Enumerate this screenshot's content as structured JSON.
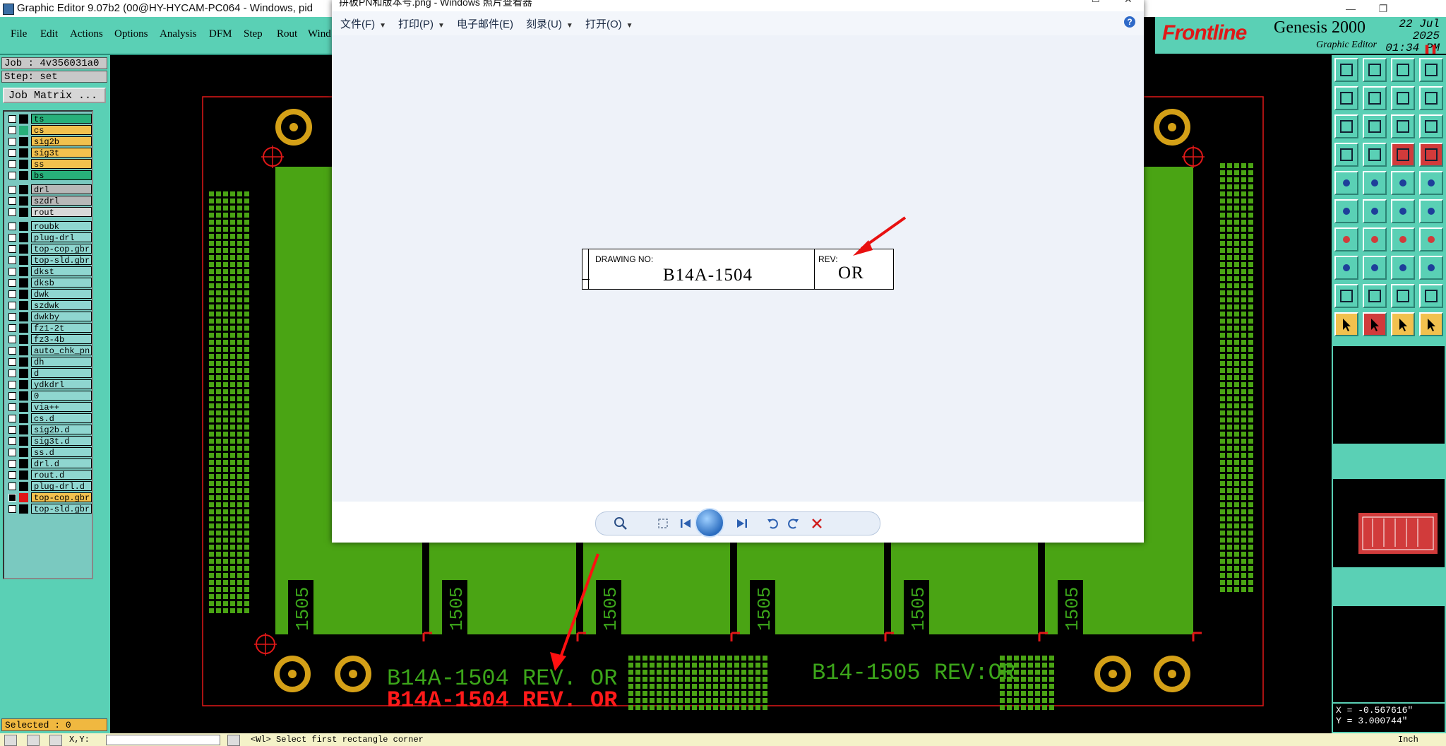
{
  "window": {
    "title": "Graphic Editor 9.07b2 (00@HY-HYCAM-PC064 - Windows, pid",
    "controls": [
      "—",
      "❐"
    ]
  },
  "menubar": {
    "items": [
      "File",
      "Edit",
      "Actions",
      "Options",
      "Analysis",
      "DFM",
      "Step",
      "Rout",
      "Wind"
    ]
  },
  "brand": {
    "logo": "Frontline",
    "product": "Genesis 2000",
    "subtitle": "Graphic Editor",
    "date": "22 Jul 2025",
    "time": "01:34 PM"
  },
  "job": {
    "job_line": "Job : 4v356031a0",
    "step_line": "Step: set",
    "matrix_button": "Job Matrix ..."
  },
  "layers": [
    {
      "name": "ts",
      "color": "#27b07a",
      "swatch": "#000000",
      "checked": false
    },
    {
      "name": "cs",
      "color": "#f2c14e",
      "swatch": "#27b07a",
      "checked": false
    },
    {
      "name": "sig2b",
      "color": "#f2c14e",
      "swatch": "#000000",
      "checked": false
    },
    {
      "name": "sig3t",
      "color": "#f2c14e",
      "swatch": "#000000",
      "checked": false
    },
    {
      "name": "ss",
      "color": "#f2c14e",
      "swatch": "#000000",
      "checked": false
    },
    {
      "name": "bs",
      "color": "#27b07a",
      "swatch": "#000000",
      "checked": false
    },
    {
      "name": "drl",
      "color": "#b8b8b8",
      "swatch": "#000000",
      "checked": false,
      "gap": true
    },
    {
      "name": "szdrl",
      "color": "#b8b8b8",
      "swatch": "#000000",
      "checked": false
    },
    {
      "name": "rout",
      "color": "#d8d8d8",
      "swatch": "#000000",
      "checked": false
    },
    {
      "name": "roubk",
      "color": "#8fd6d0",
      "swatch": "#000000",
      "checked": false,
      "gap": true
    },
    {
      "name": "plug-drl",
      "color": "#8fd6d0",
      "swatch": "#000000",
      "checked": false
    },
    {
      "name": "top-cop.gbr",
      "color": "#8fd6d0",
      "swatch": "#000000",
      "checked": false
    },
    {
      "name": "top-sld.gbr",
      "color": "#8fd6d0",
      "swatch": "#000000",
      "checked": false
    },
    {
      "name": "dkst",
      "color": "#8fd6d0",
      "swatch": "#000000",
      "checked": false
    },
    {
      "name": "dksb",
      "color": "#8fd6d0",
      "swatch": "#000000",
      "checked": false
    },
    {
      "name": "dwk",
      "color": "#8fd6d0",
      "swatch": "#000000",
      "checked": false
    },
    {
      "name": "szdwk",
      "color": "#8fd6d0",
      "swatch": "#000000",
      "checked": false
    },
    {
      "name": "dwkby",
      "color": "#8fd6d0",
      "swatch": "#000000",
      "checked": false
    },
    {
      "name": "fz1-2t",
      "color": "#8fd6d0",
      "swatch": "#000000",
      "checked": false
    },
    {
      "name": "fz3-4b",
      "color": "#8fd6d0",
      "swatch": "#000000",
      "checked": false
    },
    {
      "name": "auto_chk_pn",
      "color": "#8fd6d0",
      "swatch": "#000000",
      "checked": false
    },
    {
      "name": "dh",
      "color": "#8fd6d0",
      "swatch": "#000000",
      "checked": false
    },
    {
      "name": "d",
      "color": "#8fd6d0",
      "swatch": "#000000",
      "checked": false
    },
    {
      "name": "ydkdrl",
      "color": "#8fd6d0",
      "swatch": "#000000",
      "checked": false
    },
    {
      "name": "0",
      "color": "#8fd6d0",
      "swatch": "#000000",
      "checked": false
    },
    {
      "name": "via++",
      "color": "#8fd6d0",
      "swatch": "#000000",
      "checked": false
    },
    {
      "name": "cs.d",
      "color": "#8fd6d0",
      "swatch": "#000000",
      "checked": false
    },
    {
      "name": "sig2b.d",
      "color": "#8fd6d0",
      "swatch": "#000000",
      "checked": false
    },
    {
      "name": "sig3t.d",
      "color": "#8fd6d0",
      "swatch": "#000000",
      "checked": false
    },
    {
      "name": "ss.d",
      "color": "#8fd6d0",
      "swatch": "#000000",
      "checked": false
    },
    {
      "name": "drl.d",
      "color": "#8fd6d0",
      "swatch": "#000000",
      "checked": false
    },
    {
      "name": "rout.d",
      "color": "#8fd6d0",
      "swatch": "#000000",
      "checked": false
    },
    {
      "name": "plug-drl.d",
      "color": "#8fd6d0",
      "swatch": "#000000",
      "checked": false
    },
    {
      "name": "top-cop.gbr",
      "color": "#f2c14e",
      "swatch": "#e01818",
      "checked": true
    },
    {
      "name": "top-sld.gbr",
      "color": "#8fd6d0",
      "swatch": "#000000",
      "checked": false
    }
  ],
  "status": {
    "selected": "Selected : 0",
    "prompt": "<Wl>  Select first rectangle corner",
    "xy_label": "X,Y:",
    "unit": "Inch"
  },
  "coords": {
    "x": "X = -0.567616\"",
    "y": "Y = 3.000744\""
  },
  "board": {
    "panel_labels": [
      "1505",
      "1505",
      "1505",
      "1505",
      "1505",
      "1505"
    ],
    "text_green_left": "B14A-1504 REV. OR",
    "text_red": "B14A-1504 REV. OR",
    "text_green_right": "B14-1505 REV:OR",
    "colors": {
      "board": "#4aa414",
      "text_green": "#3ca61a",
      "text_red": "#ff1a1a",
      "pad": "#d4a017",
      "outline": "#e01818"
    }
  },
  "viewer": {
    "title": "拼板PN和版本号.png - Windows 照片查看器",
    "menu": [
      "文件(F)",
      "打印(P)",
      "电子邮件(E)",
      "刻录(U)",
      "打开(O)"
    ],
    "menu_has_arrow": [
      true,
      true,
      false,
      true,
      true
    ],
    "help": "?",
    "drawing_label": "DRAWING NO:",
    "drawing_number": "B14A-1504",
    "rev_label": "REV:",
    "rev_value": "OR",
    "control_icons": [
      "zoom-icon",
      "fit-icon",
      "previous-icon",
      "slideshow-icon",
      "next-icon",
      "rotate-left-icon",
      "rotate-right-icon",
      "delete-icon"
    ]
  }
}
